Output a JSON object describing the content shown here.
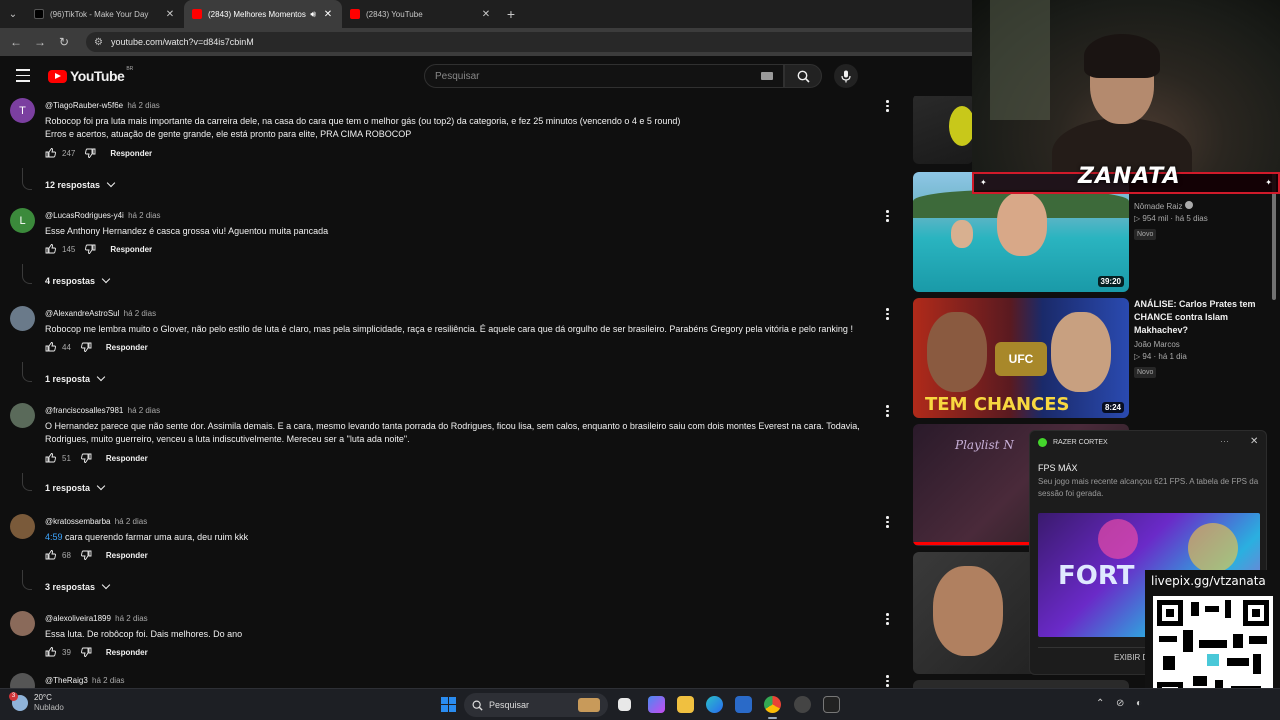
{
  "browser": {
    "tabs": [
      {
        "title": "(96)TikTok - Make Your Day",
        "active": false,
        "favicon_color": "#000000"
      },
      {
        "title": "(2843) Melhores Momentos",
        "active": true,
        "favicon_color": "#ff0000"
      },
      {
        "title": "(2843) YouTube",
        "active": false,
        "favicon_color": "#ff0000"
      }
    ],
    "url": "youtube.com/watch?v=d84is7cbinM"
  },
  "youtube": {
    "logo_text": "YouTube",
    "country": "BR",
    "search_placeholder": "Pesquisar"
  },
  "comments": [
    {
      "author": "@TiagoRauber-w5f6e",
      "when": "há 2 dias",
      "avatar_letter": "T",
      "avatar_color": "#7b3fa0",
      "lines": [
        "Robocop foi pra luta mais importante da carreira dele, na casa do cara que tem o melhor gás (ou top2) da categoria, e fez 25 minutos (vencendo o 4 e 5 round)",
        "Erros e acertos, atuação de gente grande, ele está pronto para elite, PRA CIMA ROBOCOP"
      ],
      "likes": "247",
      "reply_label": "Responder",
      "replies": "12 respostas"
    },
    {
      "author": "@LucasRodrigues-y4i",
      "when": "há 2 dias",
      "avatar_letter": "L",
      "avatar_color": "#3b8a3b",
      "lines": [
        "Esse Anthony Hernandez é casca grossa viu! Aguentou muita pancada"
      ],
      "likes": "145",
      "reply_label": "Responder",
      "replies": "4 respostas"
    },
    {
      "author": "@AlexandreAstroSul",
      "when": "há 2 dias",
      "avatar_letter": "",
      "avatar_color": "#6a7a8a",
      "lines": [
        "Robocop me lembra muito o Glover, não pelo estilo de luta é claro, mas pela simplicidade, raça e resiliência. É aquele cara que dá orgulho de ser brasileiro. Parabéns Gregory pela vitória e pelo ranking !"
      ],
      "likes": "44",
      "reply_label": "Responder",
      "replies": "1 resposta"
    },
    {
      "author": "@franciscosalles7981",
      "when": "há 2 dias",
      "avatar_letter": "",
      "avatar_color": "#5a6a5a",
      "lines": [
        "O Hernandez parece que não sente dor. Assimila demais. E a cara, mesmo levando tanta porrada do Rodrigues, ficou lisa, sem calos, enquanto o  brasileiro saiu com dois montes Everest na cara. Todavia,",
        "Rodrigues, muito guerreiro, venceu a luta indiscutivelmente.  Mereceu ser a  \"luta ada noite\"."
      ],
      "likes": "51",
      "reply_label": "Responder",
      "replies": "1 resposta"
    },
    {
      "author": "@kratossembarba",
      "when": "há 2 dias",
      "avatar_letter": "",
      "avatar_color": "#7a5a3a",
      "timestamp": "4:59",
      "lines": [
        "cara querendo farmar uma aura, deu ruim kkk"
      ],
      "likes": "68",
      "reply_label": "Responder",
      "replies": "3 respostas"
    },
    {
      "author": "@alexoliveira1899",
      "when": "há 2 dias",
      "avatar_letter": "",
      "avatar_color": "#8a6a5a",
      "lines": [
        "Essa luta. De robôcop foi. Dais melhores. Do ano"
      ],
      "likes": "39",
      "reply_label": "Responder",
      "replies": ""
    },
    {
      "author": "@TheRaig3",
      "when": "há 2 dias",
      "avatar_letter": "",
      "avatar_color": "#555555",
      "lines": [],
      "likes": "",
      "reply_label": "",
      "replies": ""
    }
  ],
  "sidebar_videos": [
    {
      "title": "",
      "channel": "Nômade Raiz",
      "verified": true,
      "views": "954 mil",
      "when": "há 5 dias",
      "badge": "Novo",
      "duration": "39:20"
    },
    {
      "title": "ANÁLISE: Carlos Prates tem CHANCE contra Islam Makhachev?",
      "channel": "João Marcos",
      "views": "94",
      "when": "há 1 dia",
      "badge": "Novo",
      "duration": "8:24",
      "thumb_text": "TEM CHANCES",
      "thumb_badge": "UFC"
    },
    {
      "title": "",
      "channel": "",
      "thumb_text": "Playlist N"
    }
  ],
  "overlay": {
    "streamer": "ZANATA",
    "livepix": "livepix.gg/vtzanata"
  },
  "razer": {
    "app": "RAZER CORTEX",
    "title": "FPS MÁX",
    "text": "Seu jogo mais recente alcançou 621 FPS. A tabela de FPS da sessão foi gerada.",
    "image_text": "FORT",
    "button": "EXIBIR D"
  },
  "taskbar": {
    "weather_temp": "20°C",
    "weather_desc": "Nublado",
    "weather_badge": "3",
    "search": "Pesquisar"
  }
}
